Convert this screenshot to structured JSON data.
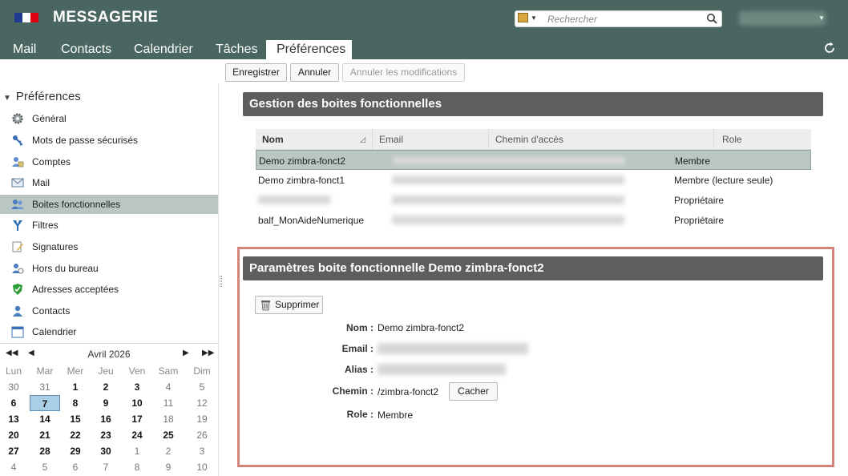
{
  "header": {
    "app_title": "MESSAGERIE",
    "search_placeholder": "Rechercher"
  },
  "tabs": [
    {
      "label": "Mail"
    },
    {
      "label": "Contacts"
    },
    {
      "label": "Calendrier"
    },
    {
      "label": "Tâches"
    },
    {
      "label": "Préférences",
      "active": true
    }
  ],
  "toolbar": {
    "save": "Enregistrer",
    "cancel": "Annuler",
    "undo_changes": "Annuler les modifications"
  },
  "sidebar": {
    "root": "Préférences",
    "items": [
      {
        "label": "Général",
        "icon": "gear-icon"
      },
      {
        "label": "Mots de passe sécurisés",
        "icon": "key-icon"
      },
      {
        "label": "Comptes",
        "icon": "accounts-icon"
      },
      {
        "label": "Mail",
        "icon": "mail-icon"
      },
      {
        "label": "Boites fonctionnelles",
        "icon": "shared-mailbox-icon",
        "selected": true
      },
      {
        "label": "Filtres",
        "icon": "filter-icon"
      },
      {
        "label": "Signatures",
        "icon": "signature-icon"
      },
      {
        "label": "Hors du bureau",
        "icon": "out-of-office-icon"
      },
      {
        "label": "Adresses acceptées",
        "icon": "shield-check-icon"
      },
      {
        "label": "Contacts",
        "icon": "contact-icon"
      },
      {
        "label": "Calendrier",
        "icon": "calendar-icon"
      }
    ]
  },
  "calendar": {
    "month": "Avril 2026",
    "days_of_week": [
      "Lun",
      "Mar",
      "Mer",
      "Jeu",
      "Ven",
      "Sam",
      "Dim"
    ],
    "weeks": [
      [
        {
          "d": "30",
          "o": 1
        },
        {
          "d": "31",
          "o": 1
        },
        {
          "d": "1"
        },
        {
          "d": "2"
        },
        {
          "d": "3"
        },
        {
          "d": "4",
          "we": 1
        },
        {
          "d": "5",
          "we": 1
        }
      ],
      [
        {
          "d": "6"
        },
        {
          "d": "7",
          "today": 1
        },
        {
          "d": "8"
        },
        {
          "d": "9"
        },
        {
          "d": "10"
        },
        {
          "d": "11",
          "we": 1
        },
        {
          "d": "12",
          "we": 1
        }
      ],
      [
        {
          "d": "13"
        },
        {
          "d": "14"
        },
        {
          "d": "15"
        },
        {
          "d": "16"
        },
        {
          "d": "17"
        },
        {
          "d": "18",
          "we": 1
        },
        {
          "d": "19",
          "we": 1
        }
      ],
      [
        {
          "d": "20"
        },
        {
          "d": "21"
        },
        {
          "d": "22"
        },
        {
          "d": "23"
        },
        {
          "d": "24"
        },
        {
          "d": "25"
        },
        {
          "d": "26",
          "we": 1
        }
      ],
      [
        {
          "d": "27"
        },
        {
          "d": "28"
        },
        {
          "d": "29"
        },
        {
          "d": "30"
        },
        {
          "d": "1",
          "o": 1
        },
        {
          "d": "2",
          "o": 1
        },
        {
          "d": "3",
          "o": 1
        }
      ],
      [
        {
          "d": "4",
          "o": 1
        },
        {
          "d": "5",
          "o": 1
        },
        {
          "d": "6",
          "o": 1
        },
        {
          "d": "7",
          "o": 1
        },
        {
          "d": "8",
          "o": 1
        },
        {
          "d": "9",
          "o": 1
        },
        {
          "d": "10",
          "o": 1
        }
      ]
    ]
  },
  "mailboxes": {
    "title": "Gestion des boites fonctionnelles",
    "columns": {
      "name": "Nom",
      "email": "Email",
      "path": "Chemin d'accès",
      "role": "Role"
    },
    "rows": [
      {
        "name": "Demo zimbra-fonct2",
        "role": "Membre",
        "selected": true
      },
      {
        "name": "Demo zimbra-fonct1",
        "role": "Membre (lecture seule)"
      },
      {
        "name": "",
        "role": "Propriétaire"
      },
      {
        "name": "balf_MonAideNumerique",
        "role": "Propriétaire"
      }
    ]
  },
  "params": {
    "title": "Paramètres boite fonctionnelle Demo zimbra-fonct2",
    "delete_button": "Supprimer",
    "labels": {
      "name": "Nom :",
      "email": "Email :",
      "alias": "Alias :",
      "path": "Chemin :",
      "role": "Role :"
    },
    "name_value": "Demo zimbra-fonct2",
    "path_value": "/zimbra-fonct2",
    "hide_button": "Cacher",
    "role_value": "Membre"
  }
}
